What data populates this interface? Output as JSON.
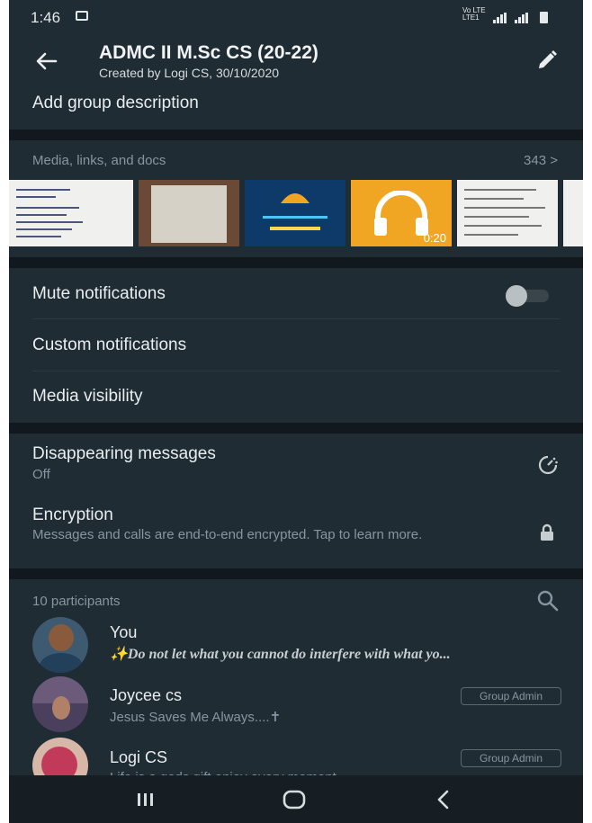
{
  "status_bar": {
    "time": "1:46",
    "network": "Vo LTE LTE1"
  },
  "header": {
    "title": "ADMC II M.Sc CS (20-22)",
    "subtitle": "Created by Logi CS, 30/10/2020"
  },
  "description": {
    "label": "Add group description"
  },
  "media": {
    "heading": "Media, links, and docs",
    "count": "343 >",
    "audio_duration": "0:20"
  },
  "settings": {
    "mute": {
      "label": "Mute notifications",
      "enabled": false
    },
    "custom": {
      "label": "Custom notifications"
    },
    "visibility": {
      "label": "Media visibility"
    },
    "disappearing": {
      "label": "Disappearing messages",
      "value": "Off"
    },
    "encryption": {
      "label": "Encryption",
      "description": "Messages and calls are end-to-end encrypted. Tap to learn more."
    }
  },
  "participants": {
    "heading": "10 participants",
    "list": [
      {
        "name": "You",
        "status": "✨Do not let what you cannot do interfere with what yo..."
      },
      {
        "name": "Joycee cs",
        "status": "Jesus Saves Me Always....✝",
        "badge": "Group Admin"
      },
      {
        "name": "Logi CS",
        "status": "Life is a gods gift enjoy every moment",
        "badge": "Group Admin"
      }
    ]
  },
  "colors": {
    "background": "#12191e",
    "surface": "#1f2c34",
    "secondary_text": "#8696a0",
    "audio_thumb": "#f1a623"
  }
}
